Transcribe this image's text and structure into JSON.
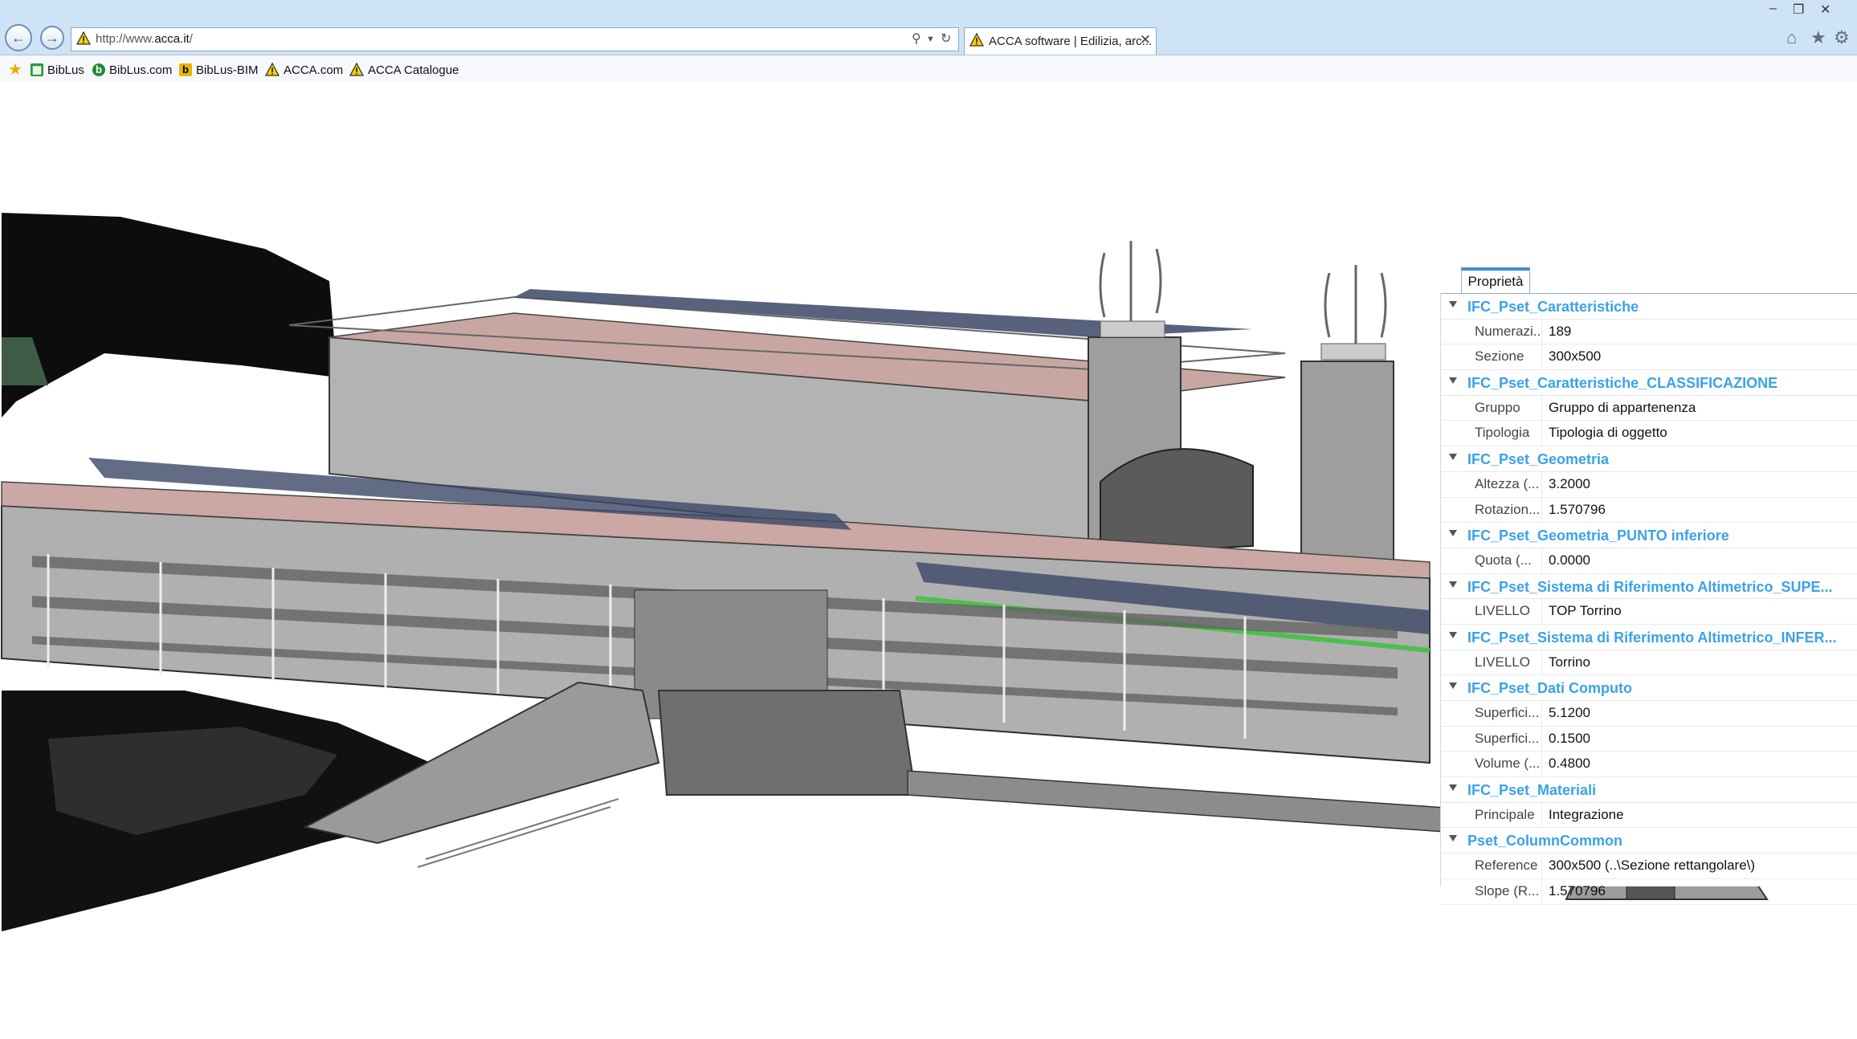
{
  "browser": {
    "address_scheme": "http://www.",
    "address_host": "acca.it",
    "address_path": "/",
    "tab_title": "ACCA software | Edilizia, arc...",
    "favorites": [
      {
        "label": "BibLus",
        "icon": "biblus-icon"
      },
      {
        "label": "BibLus.com",
        "icon": "biblus-com-icon"
      },
      {
        "label": "BibLus-BIM",
        "icon": "biblus-bim-icon"
      },
      {
        "label": "ACCA.com",
        "icon": "acca-warning-icon"
      },
      {
        "label": "ACCA Catalogue",
        "icon": "acca-warning-icon"
      }
    ]
  },
  "panel": {
    "tab_label": "Proprietà",
    "groups": [
      {
        "name": "IFC_Pset_Caratteristiche",
        "rows": [
          {
            "key": "Numerazi...",
            "value": "189"
          },
          {
            "key": "Sezione",
            "value": "300x500"
          }
        ]
      },
      {
        "name": "IFC_Pset_Caratteristiche_CLASSIFICAZIONE",
        "rows": [
          {
            "key": "Gruppo",
            "value": "Gruppo di appartenenza"
          },
          {
            "key": "Tipologia",
            "value": "Tipologia di oggetto"
          }
        ]
      },
      {
        "name": "IFC_Pset_Geometria",
        "rows": [
          {
            "key": "Altezza (...",
            "value": "3.2000"
          },
          {
            "key": "Rotazion...",
            "value": "1.570796"
          }
        ]
      },
      {
        "name": "IFC_Pset_Geometria_PUNTO inferiore",
        "rows": [
          {
            "key": "Quota (...",
            "value": "0.0000"
          }
        ]
      },
      {
        "name": "IFC_Pset_Sistema di Riferimento Altimetrico_SUPE...",
        "rows": [
          {
            "key": "LIVELLO",
            "value": "TOP Torrino"
          }
        ]
      },
      {
        "name": "IFC_Pset_Sistema di Riferimento Altimetrico_INFER...",
        "rows": [
          {
            "key": "LIVELLO",
            "value": "Torrino"
          }
        ]
      },
      {
        "name": "IFC_Pset_Dati Computo",
        "rows": [
          {
            "key": "Superfici...",
            "value": "5.1200"
          },
          {
            "key": "Superfici...",
            "value": "0.1500"
          },
          {
            "key": "Volume (...",
            "value": "0.4800"
          }
        ]
      },
      {
        "name": "IFC_Pset_Materiali",
        "rows": [
          {
            "key": "Principale",
            "value": "Integrazione"
          }
        ]
      },
      {
        "name": "Pset_ColumnCommon",
        "rows": [
          {
            "key": "Reference",
            "value": "300x500   (..\\Sezione rettangolare\\)"
          },
          {
            "key": "Slope (R...",
            "value": "1.570796"
          }
        ]
      }
    ]
  },
  "colors": {
    "accent": "#3aa2e8",
    "titlebar": "#cfe3f6",
    "building_gray": "#a9a9a9",
    "roof_pink": "#c9a3a0",
    "solar_navy": "#3b4766"
  }
}
